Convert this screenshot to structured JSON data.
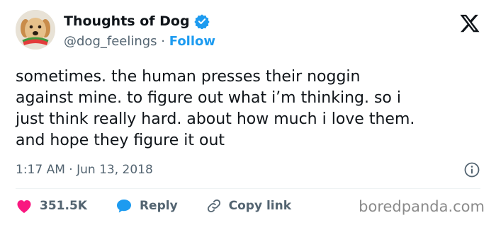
{
  "author": {
    "display_name": "Thoughts of Dog",
    "handle": "@dog_feelings",
    "separator": " · ",
    "follow_label": "Follow",
    "verified": true
  },
  "tweet": {
    "text": "sometimes. the human presses their noggin\nagainst mine. to figure out what i’m thinking. so i\njust think really hard. about how much i love them.\nand hope they figure it out",
    "time": "1:17 AM",
    "date": "Jun 13, 2018",
    "meta_separator": " · "
  },
  "actions": {
    "likes": "351.5K",
    "reply_label": "Reply",
    "copy_link_label": "Copy link"
  },
  "watermark": "boredpanda.com",
  "icons": {
    "brand": "x-logo-icon",
    "verified": "verified-badge-icon",
    "info": "info-icon",
    "like": "heart-icon",
    "reply": "speech-bubble-icon",
    "copy": "link-icon"
  },
  "colors": {
    "accent": "#1d9bf0",
    "like": "#f91880",
    "text": "#0f1419",
    "secondary": "#536471"
  }
}
